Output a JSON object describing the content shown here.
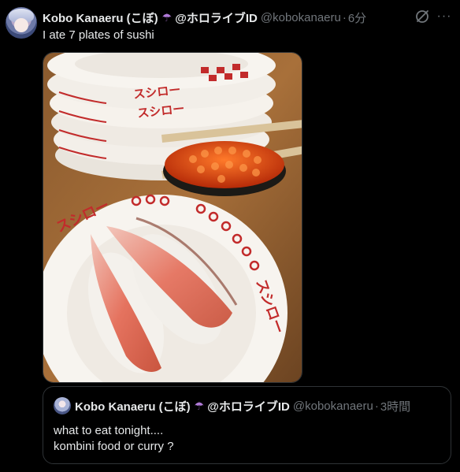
{
  "author": {
    "name": "Kobo Kanaeru (こぼ)",
    "tag": "@ホロライブID",
    "handle": "@kobokanaeru",
    "separator": "·",
    "time": "6分",
    "badge_icon": "umbrella-icon"
  },
  "tweet": {
    "text": "I ate 7 plates of sushi",
    "media": {
      "plate_text": "スシロー"
    }
  },
  "quote": {
    "name": "Kobo Kanaeru (こぼ)",
    "tag": "@ホロライブID",
    "handle": "@kobokanaeru",
    "separator": "·",
    "time": "3時間",
    "line1": "what to eat tonight....",
    "line2": "kombini food or curry ?"
  },
  "actions": {
    "grok_icon": "grok-icon",
    "more_icon": "more-icon",
    "more_label": "···"
  },
  "colors": {
    "background": "#000000",
    "text": "#e7e9ea",
    "muted": "#71767b",
    "border": "#2f3336"
  }
}
